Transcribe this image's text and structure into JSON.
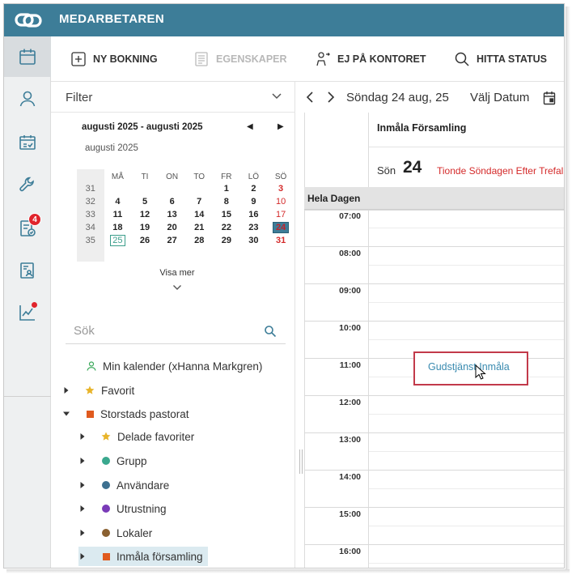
{
  "app": {
    "title": "MEDARBETAREN"
  },
  "rail": {
    "badge_count": "4",
    "icons": [
      "calendar-icon",
      "person-icon",
      "calendar-check-icon",
      "wrench-icon",
      "task-icon",
      "document-person-icon",
      "chart-icon"
    ]
  },
  "toolbar": {
    "new_booking": "NY BOKNING",
    "properties": "EGENSKAPER",
    "out_of_office": "EJ PÅ KONTORET",
    "find_status": "HITTA STATUS"
  },
  "filter": {
    "label": "Filter"
  },
  "mini_calendar": {
    "range_title": "augusti 2025 - augusti 2025",
    "month_label": "augusti 2025",
    "weekday_headers": [
      "MÅ",
      "TI",
      "ON",
      "TO",
      "FR",
      "LÖ",
      "SÖ"
    ],
    "weeks": [
      {
        "wk": "31",
        "days": [
          "",
          "",
          "",
          "",
          "1",
          "2",
          "3"
        ]
      },
      {
        "wk": "32",
        "days": [
          "4",
          "5",
          "6",
          "7",
          "8",
          "9",
          "10"
        ]
      },
      {
        "wk": "33",
        "days": [
          "11",
          "12",
          "13",
          "14",
          "15",
          "16",
          "17"
        ]
      },
      {
        "wk": "34",
        "days": [
          "18",
          "19",
          "20",
          "21",
          "22",
          "23",
          "24"
        ]
      },
      {
        "wk": "35",
        "days": [
          "25",
          "26",
          "27",
          "28",
          "29",
          "30",
          "31"
        ]
      }
    ],
    "show_more": "Visa mer"
  },
  "search": {
    "placeholder": "Sök"
  },
  "tree": {
    "my_calendar": "Min kalender (xHanna Markgren)",
    "favorites": "Favorit",
    "parish": "Storstads pastorat",
    "shared_favorites": "Delade favoriter",
    "group": "Grupp",
    "users": "Användare",
    "equipment": "Utrustning",
    "premises": "Lokaler",
    "register_parish": "Inmåla församling",
    "colors": {
      "parish": "#e05a1e",
      "group": "#3aa88e",
      "users": "#3d7090",
      "equipment": "#7a3bb8",
      "premises": "#8a6030",
      "star": "#e8b42a"
    }
  },
  "calendar": {
    "current_date": "Söndag 24 aug, 25",
    "pick_date": "Välj Datum",
    "resource_name": "Inmåla Församling",
    "day_name": "Sön",
    "day_number": "24",
    "holiday": "Tionde Söndagen Efter Trefal",
    "all_day": "Hela Dagen",
    "hours": [
      "07:00",
      "08:00",
      "09:00",
      "10:00",
      "11:00",
      "12:00",
      "13:00",
      "14:00",
      "15:00",
      "16:00"
    ],
    "event": {
      "title": "Gudstjänst Inmåla"
    }
  },
  "theme": {
    "accent": "#3d7d98",
    "holiday_red": "#d42a2a",
    "event_border": "#c23a4a"
  }
}
